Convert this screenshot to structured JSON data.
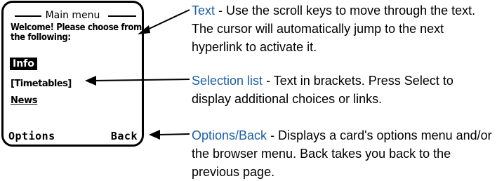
{
  "phone": {
    "title": "Main menu",
    "welcome": "Welcome! Please choose from the following:",
    "items": [
      {
        "label": "Info"
      },
      {
        "label": "[Timetables]"
      },
      {
        "label": "News"
      }
    ],
    "softkeys": {
      "left": "Options",
      "right": "Back"
    }
  },
  "callouts": [
    {
      "term": "Text",
      "text": " - Use the scroll keys to move through the text. The cursor will automatically jump to the next hyperlink to activate it."
    },
    {
      "term": "Selection list",
      "text": " - Text in brackets. Press Select to display additional choices or links."
    },
    {
      "term": "Options/Back",
      "text": " - Displays a card's options menu and/or the browser menu. Back takes you back to the previous page."
    }
  ],
  "colors": {
    "term": "#1d5fa8"
  }
}
